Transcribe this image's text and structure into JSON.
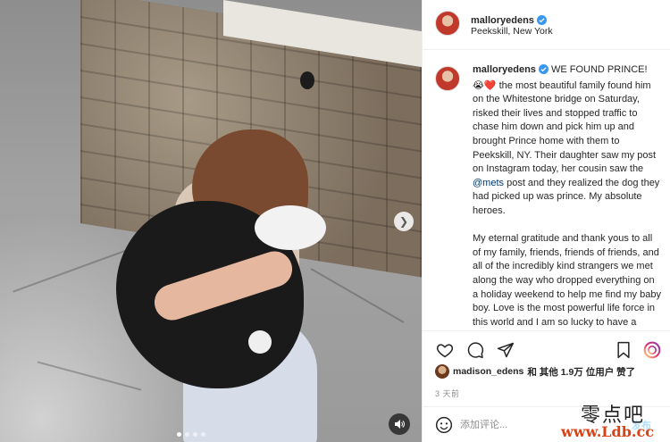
{
  "header": {
    "username": "malloryedens",
    "location": "Peekskill, New York"
  },
  "caption": {
    "username": "malloryedens",
    "headline": "WE FOUND PRINCE!",
    "hearts": "😭❤️",
    "paragraph1": "the most beautiful family found him on the Whitestone bridge on Saturday, risked their lives and stopped traffic to chase him down and pick him up and brought Prince home with them to Peekskill, NY. Their daughter saw my post on Instagram today, her cousin saw the",
    "mention": "@mets",
    "paragraph1_end": "post and they realized the dog they had picked up was prince. My absolute heroes.",
    "paragraph2": "My eternal gratitude and thank yous to all of my family, friends, friends of friends, and all of the incredibly kind strangers we met along the way who dropped everything on a holiday weekend to help me find my baby boy. Love is the most powerful life force in this world and I am so lucky to have a"
  },
  "likes": {
    "liker": "madison_edens",
    "text": "和 其他 1.9万 位用户 赞了"
  },
  "time": "3 天前",
  "comment": {
    "placeholder": "添加评论...",
    "post_label": "发布"
  },
  "watermark": {
    "title": "零点吧",
    "url": "www.Ldb.cc"
  },
  "colors": {
    "verified": "#3897f0",
    "mention": "#00376b",
    "post_disabled": "#b2dffc",
    "reels_icon": "#e1306c"
  },
  "carousel": {
    "slides": 4,
    "active_index": 0
  }
}
